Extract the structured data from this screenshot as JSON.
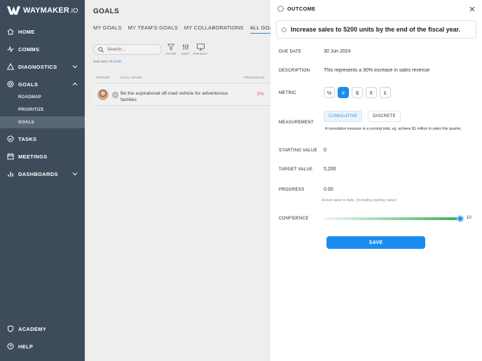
{
  "brand": {
    "name": "WAYMAKER",
    "suffix": ".IO"
  },
  "sidebar": {
    "items": [
      {
        "label": "HOME",
        "icon": "home-icon"
      },
      {
        "label": "COMMS",
        "icon": "pulse-icon"
      },
      {
        "label": "DIAGNOSTICS",
        "icon": "warning-icon"
      },
      {
        "label": "GOALS",
        "icon": "target-icon"
      },
      {
        "label": "TASKS",
        "icon": "check-circle-icon"
      },
      {
        "label": "MEETINGS",
        "icon": "calendar-icon"
      },
      {
        "label": "DASHBOARDS",
        "icon": "bar-chart-icon"
      },
      {
        "label": "ACADEMY",
        "icon": "shield-icon"
      },
      {
        "label": "HELP",
        "icon": "help-icon"
      }
    ],
    "goals_sub": [
      {
        "label": "ROADMAP"
      },
      {
        "label": "PRIORITIZE"
      },
      {
        "label": "GOALS"
      }
    ]
  },
  "main": {
    "title": "GOALS",
    "tabs": [
      {
        "label": "MY GOALS"
      },
      {
        "label": "MY TEAM'S GOALS"
      },
      {
        "label": "MY COLLABORATIONS"
      },
      {
        "label": "ALL GOALS"
      }
    ],
    "search": {
      "placeholder": "Search..."
    },
    "tools": [
      {
        "label": "FILTER",
        "icon": "filter-icon"
      },
      {
        "label": "SORT",
        "icon": "sort-icon"
      },
      {
        "label": "PRESENT",
        "icon": "monitor-icon"
      }
    ],
    "goal_view": {
      "prefix": "Goal view:",
      "value": "All Goals"
    },
    "columns": {
      "owner": "OWNER",
      "goal_name": "GOAL NAME",
      "progress": "PROGRESS"
    },
    "goals": [
      {
        "name": "Be the aspirational off-road vehicle for adventurous families",
        "progress": "0%"
      }
    ]
  },
  "panel": {
    "header": "OUTCOME",
    "title": "Increase sales to 5200 units by the end of the fiscal year.",
    "fields": {
      "due_date": {
        "label": "DUE DATE",
        "value": "30 Jun 2024"
      },
      "description": {
        "label": "DESCRIPTION",
        "value": "This represents a 30% increase in sales revenue"
      },
      "metric": {
        "label": "METRIC",
        "options": [
          "%",
          "#",
          "$",
          "€",
          "£"
        ],
        "selected": "#"
      },
      "measurement": {
        "label": "MEASUREMENT",
        "options": [
          "CUMULATIVE",
          "DISCRETE"
        ],
        "selected": "CUMULATIVE",
        "note": "A cumulative measure is a running total, eg. achieve $1 million in sales this quarter."
      },
      "starting_value": {
        "label": "STARTING VALUE",
        "value": "0"
      },
      "target_value": {
        "label": "TARGET VALUE",
        "value": "5,200"
      },
      "progress": {
        "label": "PROGRESS",
        "value": "0.00",
        "hint": "Actual value to date, (including starting value)"
      },
      "confidence": {
        "label": "CONFIDENCE",
        "value": "10",
        "max": 10
      }
    },
    "save_label": "SAVE"
  },
  "colors": {
    "accent": "#1a8cf0",
    "sidebar": "#3d4b5b",
    "danger": "#e06666"
  }
}
